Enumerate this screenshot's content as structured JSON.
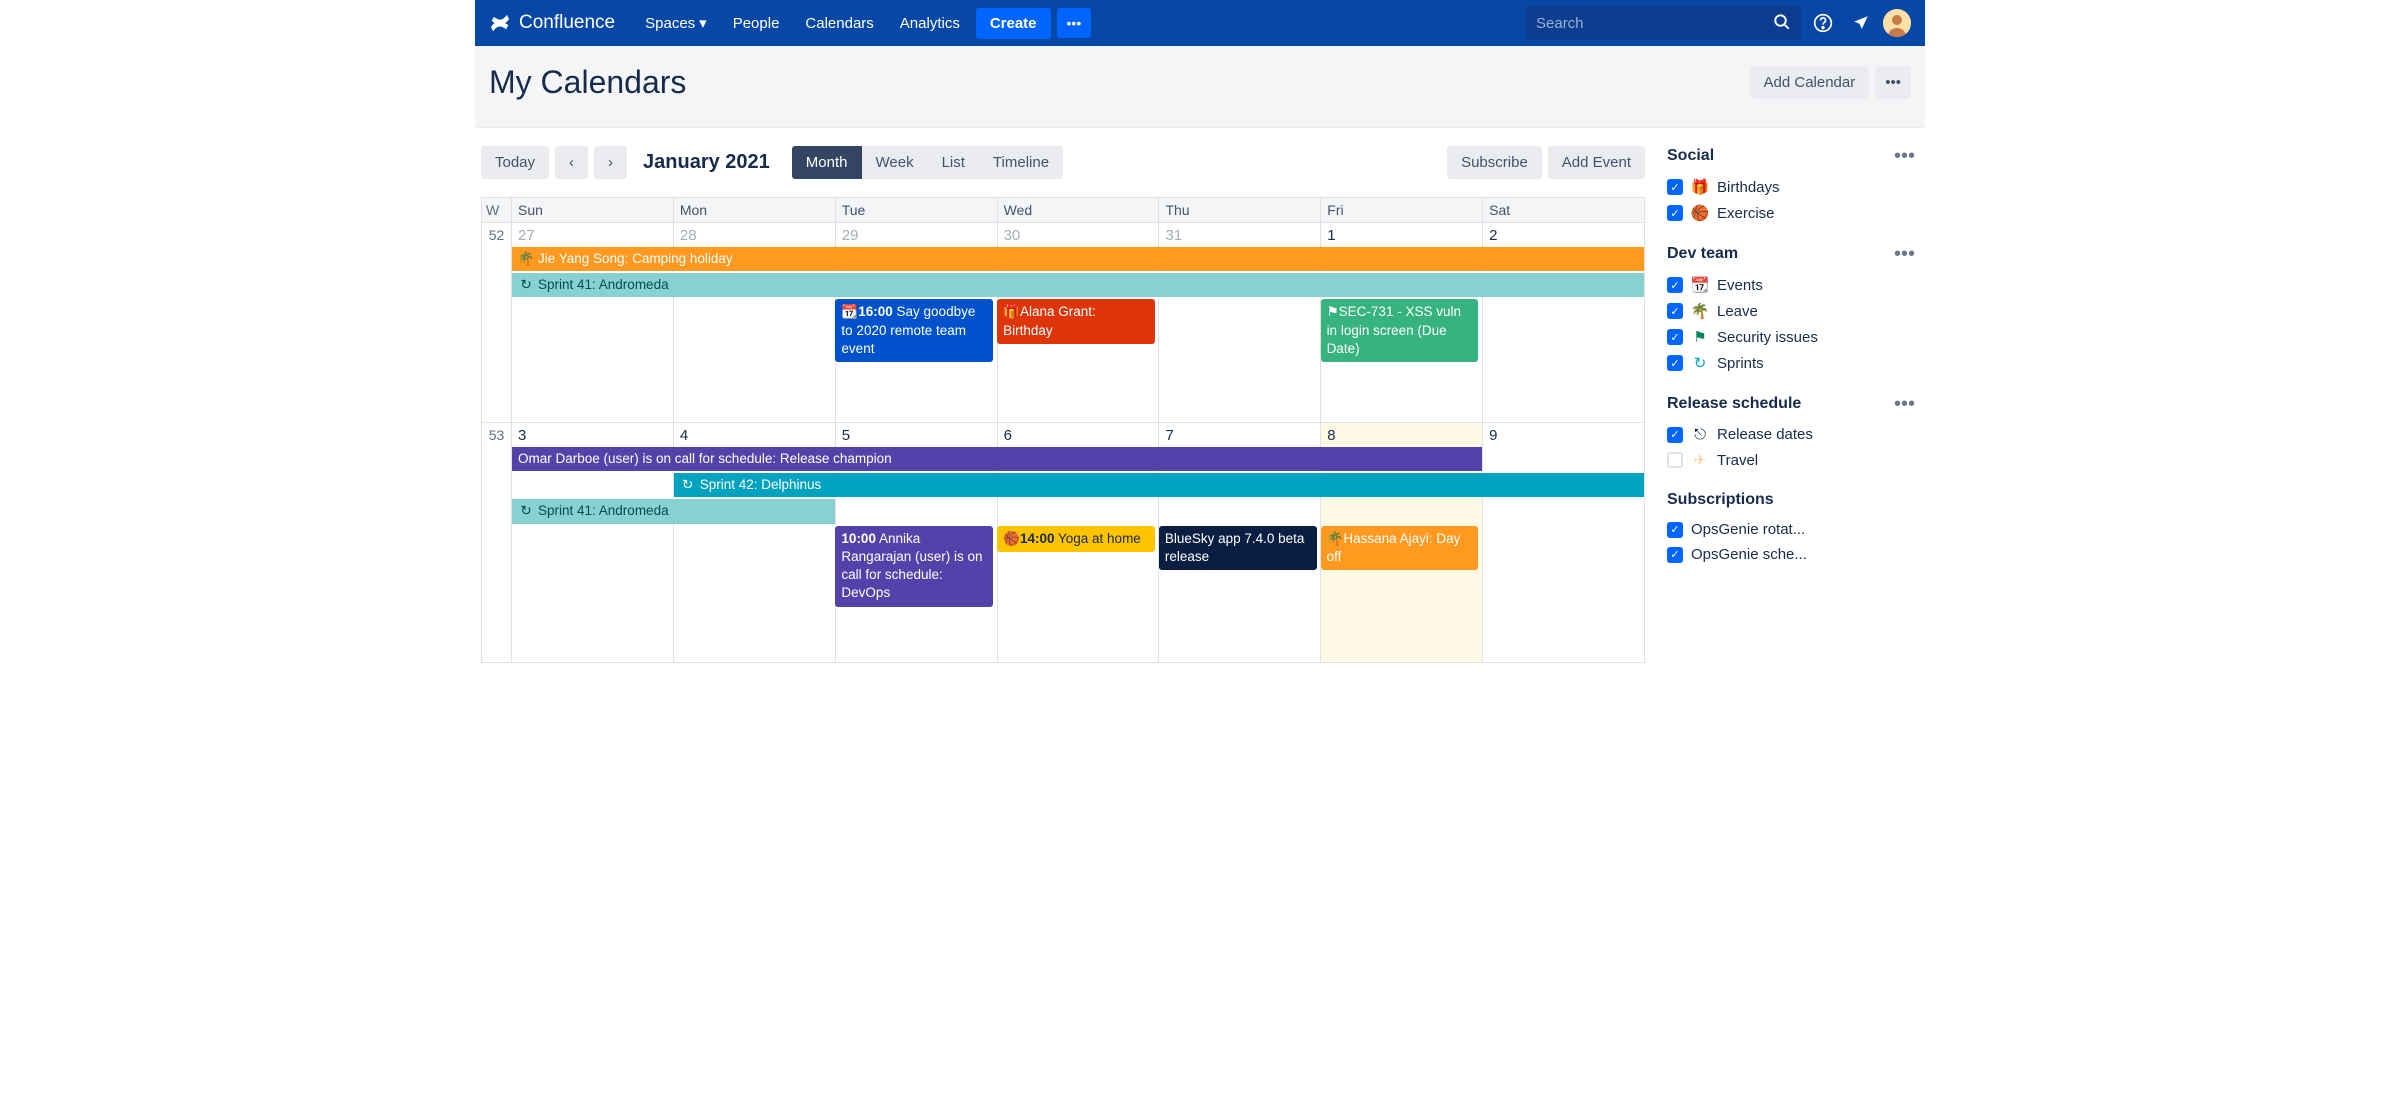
{
  "nav": {
    "brand": "Confluence",
    "items": [
      "Spaces",
      "People",
      "Calendars",
      "Analytics"
    ],
    "create": "Create",
    "search_placeholder": "Search"
  },
  "page": {
    "title": "My Calendars",
    "add_calendar": "Add Calendar"
  },
  "toolbar": {
    "today": "Today",
    "period": "January 2021",
    "views": {
      "month": "Month",
      "week": "Week",
      "list": "List",
      "timeline": "Timeline"
    },
    "subscribe": "Subscribe",
    "add_event": "Add Event"
  },
  "grid": {
    "wk_label": "W",
    "days": [
      "Sun",
      "Mon",
      "Tue",
      "Wed",
      "Thu",
      "Fri",
      "Sat"
    ],
    "weeks": [
      {
        "num": "52",
        "dates": [
          {
            "n": "27",
            "mut": 1
          },
          {
            "n": "28",
            "mut": 1
          },
          {
            "n": "29",
            "mut": 1
          },
          {
            "n": "30",
            "mut": 1
          },
          {
            "n": "31",
            "mut": 1
          },
          {
            "n": "1"
          },
          {
            "n": "2"
          }
        ]
      },
      {
        "num": "53",
        "dates": [
          {
            "n": "3"
          },
          {
            "n": "4"
          },
          {
            "n": "5"
          },
          {
            "n": "6"
          },
          {
            "n": "7"
          },
          {
            "n": "8",
            "hl": 1
          },
          {
            "n": "9"
          }
        ]
      }
    ]
  },
  "events": {
    "w0": {
      "bar1": "Jie Yang Song: Camping holiday",
      "bar2": "Sprint 41: Andromeda",
      "tue": {
        "time": "16:00",
        "txt": "Say goodbye to 2020 remote team event"
      },
      "wed": "Alana Grant: Birthday",
      "fri": "SEC-731 - XSS vuln in login screen (Due Date)"
    },
    "w1": {
      "bar1": "Omar Darboe (user) is on call for schedule: Release champion",
      "bar2": "Sprint 42: Delphinus",
      "bar3": "Sprint 41: Andromeda",
      "tue": {
        "time": "10:00",
        "txt": "Annika Rangarajan (user) is on call for schedule: DevOps"
      },
      "wed": {
        "time": "14:00",
        "txt": "Yoga at home"
      },
      "thu": "BlueSky app 7.4.0 beta release",
      "fri": "Hassana Ajayi: Day off"
    }
  },
  "side": {
    "groups": [
      {
        "title": "Social",
        "items": [
          {
            "chk": 1,
            "icon": "gift",
            "color": "#de350b",
            "label": "Birthdays"
          },
          {
            "chk": 1,
            "icon": "ball",
            "color": "#ffab00",
            "label": "Exercise"
          }
        ]
      },
      {
        "title": "Dev team",
        "items": [
          {
            "chk": 1,
            "icon": "calendar",
            "color": "#0747a6",
            "label": "Events"
          },
          {
            "chk": 1,
            "icon": "palm",
            "color": "#ff991f",
            "label": "Leave"
          },
          {
            "chk": 1,
            "icon": "issue",
            "color": "#00875a",
            "label": "Security issues"
          },
          {
            "chk": 1,
            "icon": "sprint",
            "color": "#00a3bf",
            "label": "Sprints"
          }
        ]
      },
      {
        "title": "Release schedule",
        "items": [
          {
            "chk": 1,
            "icon": "release",
            "color": "#091e42",
            "label": "Release dates"
          },
          {
            "chk": 0,
            "icon": "plane",
            "color": "#ffd29e",
            "label": "Travel"
          }
        ]
      },
      {
        "title": "Subscriptions",
        "noMenu": 1,
        "items": [
          {
            "chk": 1,
            "icon": "",
            "color": "",
            "label": "OpsGenie rotat..."
          },
          {
            "chk": 1,
            "icon": "",
            "color": "",
            "label": "OpsGenie sche..."
          }
        ]
      }
    ]
  }
}
